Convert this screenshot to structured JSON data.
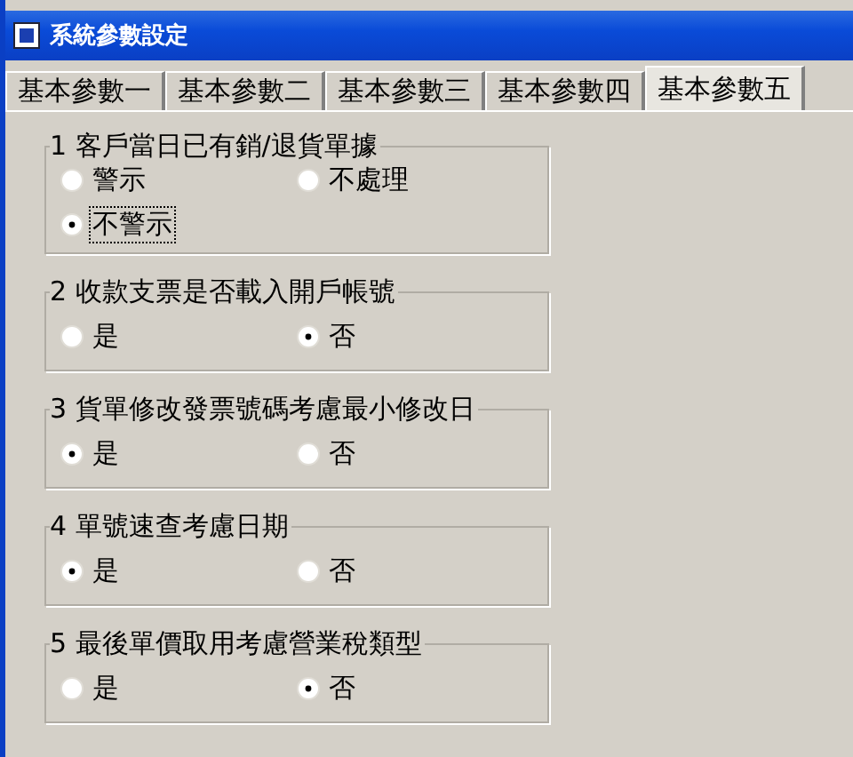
{
  "window": {
    "title": "系統參數設定"
  },
  "tabs": [
    {
      "label": "基本參數一",
      "selected": false
    },
    {
      "label": "基本參數二",
      "selected": false
    },
    {
      "label": "基本參數三",
      "selected": false
    },
    {
      "label": "基本參數四",
      "selected": false
    },
    {
      "label": "基本參數五",
      "selected": true
    }
  ],
  "groups": [
    {
      "title": "1 客戶當日已有銷/退貨單據",
      "options": [
        {
          "label": "警示",
          "selected": false,
          "focused": false
        },
        {
          "label": "不處理",
          "selected": false,
          "focused": false
        },
        {
          "label": "不警示",
          "selected": true,
          "focused": true
        }
      ]
    },
    {
      "title": "2 收款支票是否載入開戶帳號",
      "options": [
        {
          "label": "是",
          "selected": false,
          "focused": false
        },
        {
          "label": "否",
          "selected": true,
          "focused": false
        }
      ]
    },
    {
      "title": "3 貨單修改發票號碼考慮最小修改日",
      "options": [
        {
          "label": "是",
          "selected": true,
          "focused": false
        },
        {
          "label": "否",
          "selected": false,
          "focused": false
        }
      ]
    },
    {
      "title": "4 單號速查考慮日期",
      "options": [
        {
          "label": "是",
          "selected": true,
          "focused": false
        },
        {
          "label": "否",
          "selected": false,
          "focused": false
        }
      ]
    },
    {
      "title": "5 最後單價取用考慮營業稅類型",
      "options": [
        {
          "label": "是",
          "selected": false,
          "focused": false
        },
        {
          "label": "否",
          "selected": true,
          "focused": false
        }
      ]
    }
  ]
}
